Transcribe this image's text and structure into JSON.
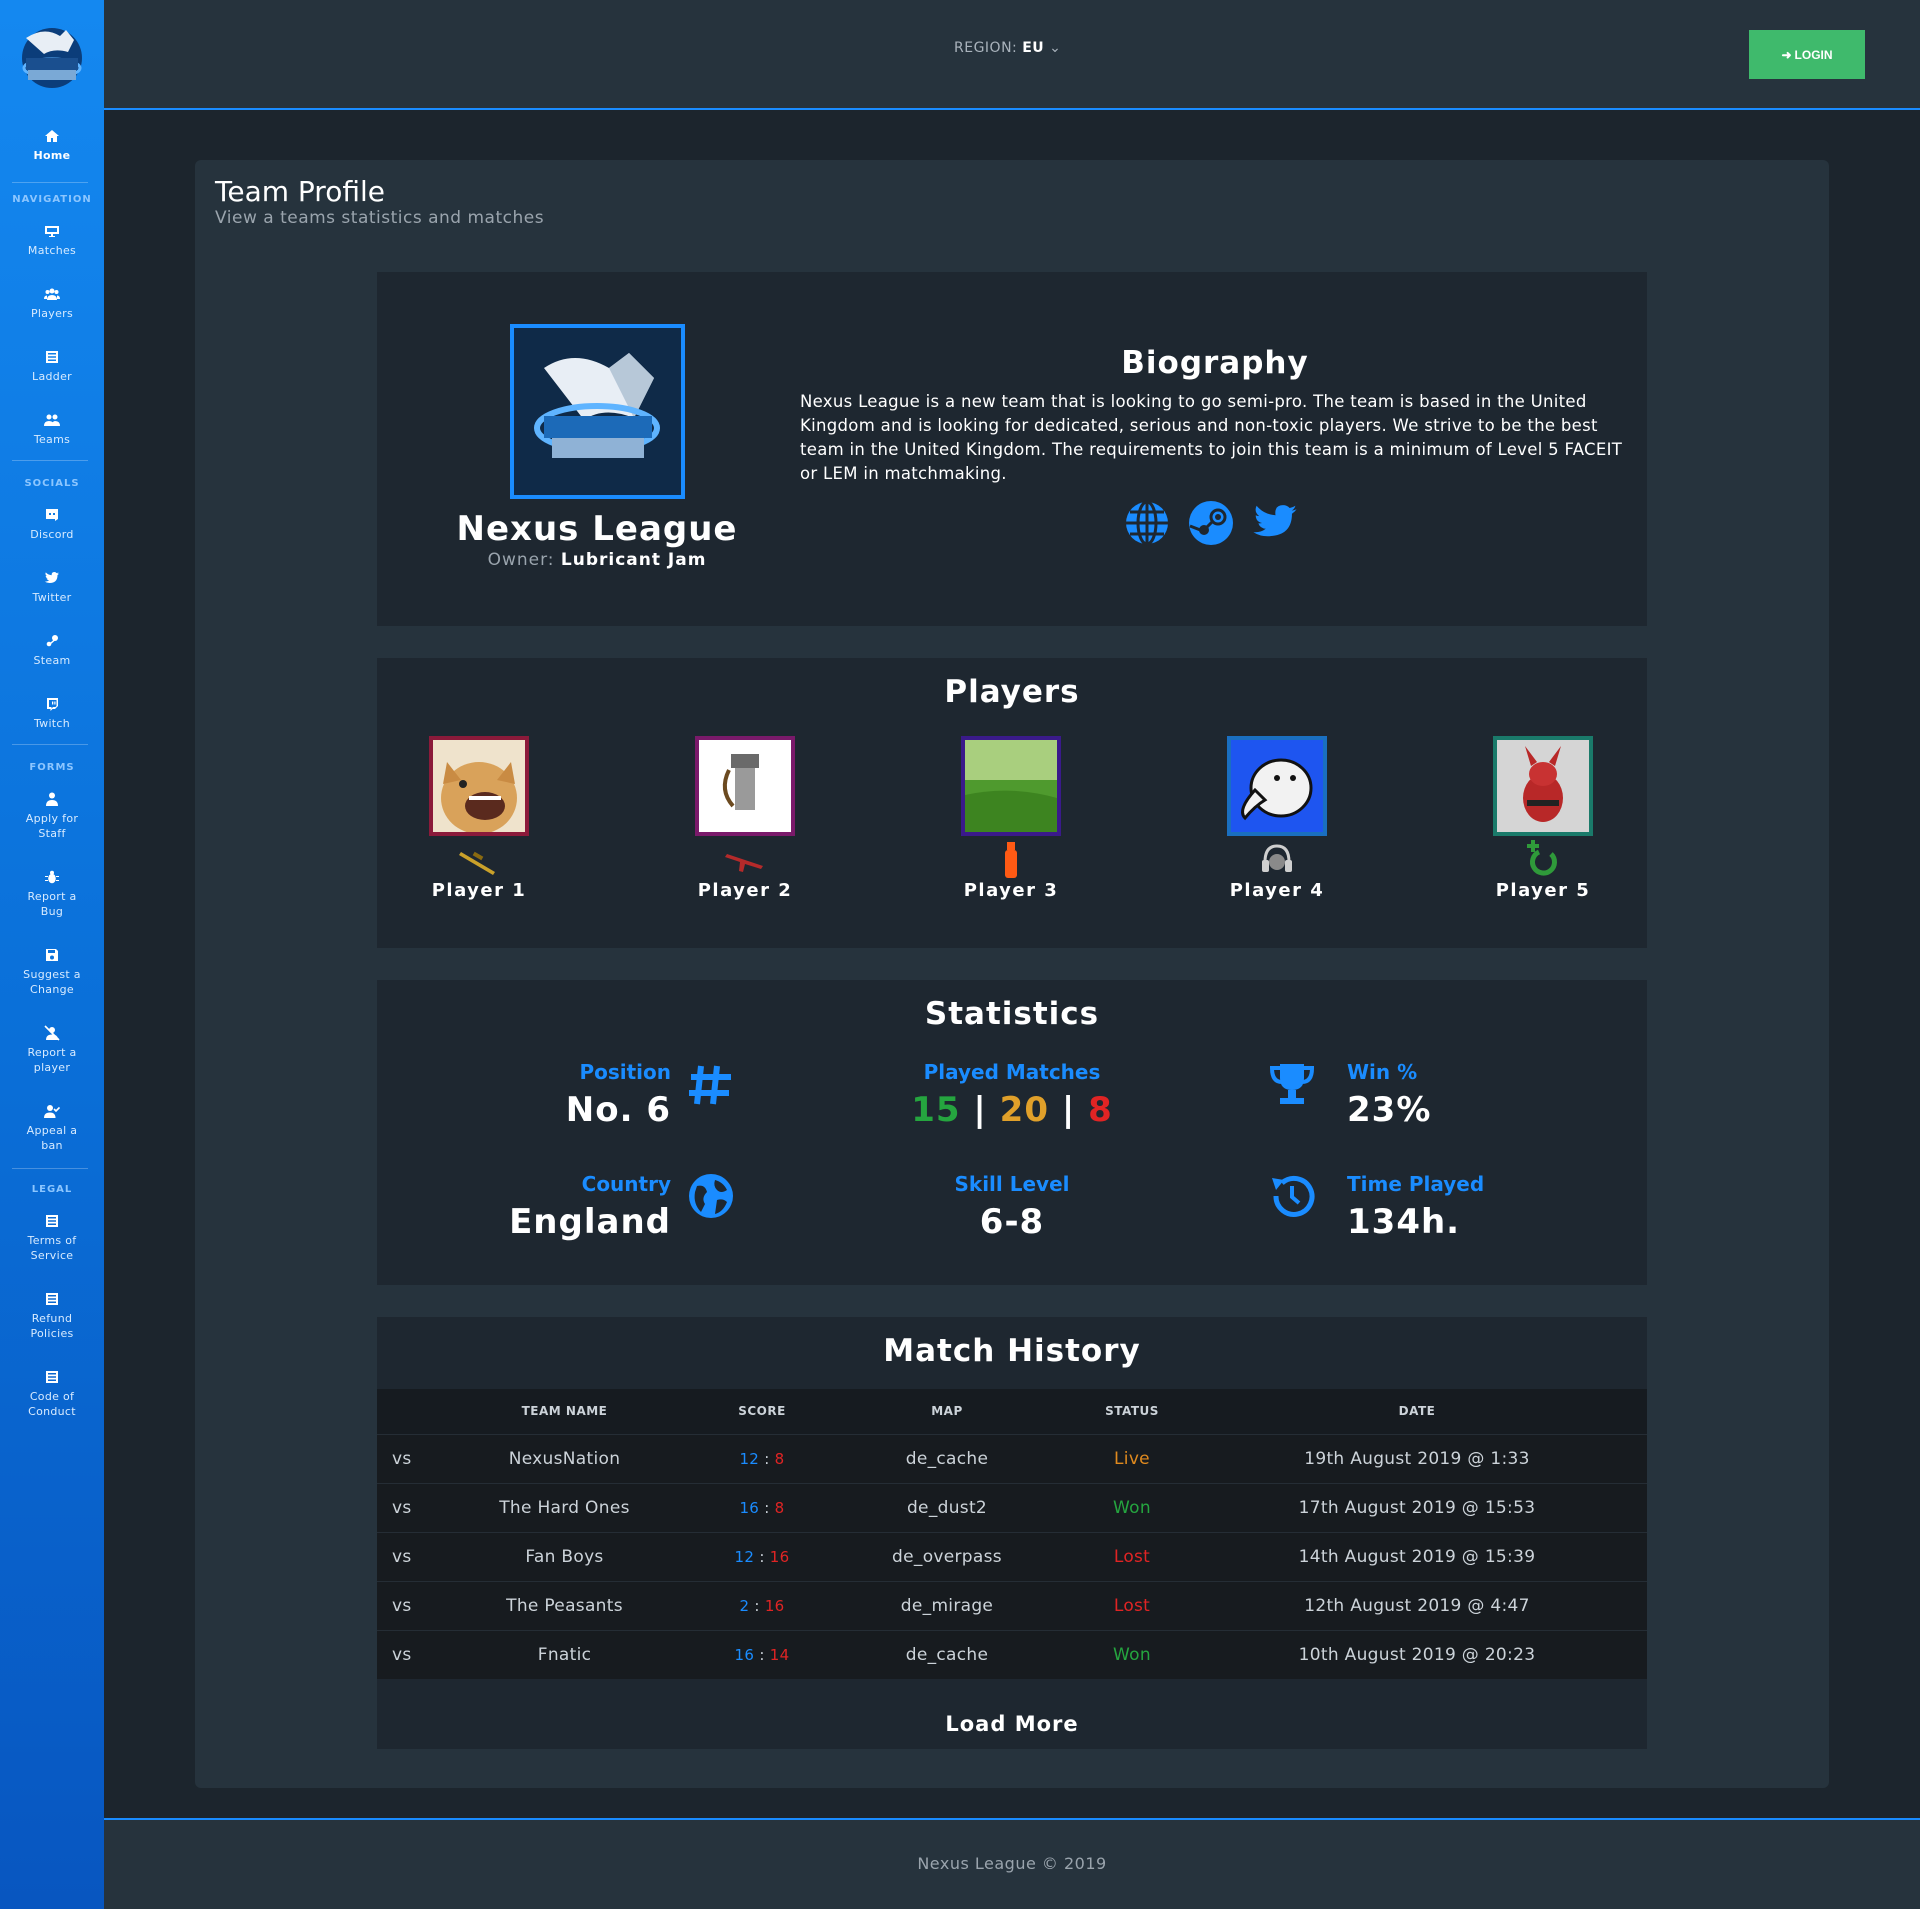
{
  "sidebar": {
    "home": "Home",
    "sections": {
      "navigation": "NAVIGATION",
      "socials": "SOCIALS",
      "forms": "FORMS",
      "legal": "LEGAL"
    },
    "nav": [
      "Matches",
      "Players",
      "Ladder",
      "Teams"
    ],
    "socials": [
      "Discord",
      "Twitter",
      "Steam",
      "Twitch"
    ],
    "forms": [
      [
        "Apply for",
        "Staff"
      ],
      [
        "Report a",
        "Bug"
      ],
      [
        "Suggest a",
        "Change"
      ],
      [
        "Report a",
        "player"
      ],
      [
        "Appeal a",
        "ban"
      ]
    ],
    "legal": [
      [
        "Terms of",
        "Service"
      ],
      [
        "Refund",
        "Policies"
      ],
      [
        "Code of",
        "Conduct"
      ]
    ]
  },
  "topbar": {
    "region_label": "REGION:",
    "region_value": "EU",
    "login": "LOGIN"
  },
  "page": {
    "title": "Team Profile",
    "subtitle": "View a teams statistics and matches"
  },
  "team": {
    "name": "Nexus League",
    "owner_label": "Owner:",
    "owner": "Lubricant Jam",
    "bio_heading": "Biography",
    "bio": "Nexus League is a new team that is looking to go semi-pro. The team is based in the United Kingdom and is looking for dedicated, serious and non-toxic players. We strive to be the best team in the United Kingdom. The requirements to join this team is a minimum of Level 5 FACEIT or LEM in matchmaking.",
    "socials": [
      "globe-icon",
      "steam-icon",
      "twitter-icon"
    ]
  },
  "players": {
    "heading": "Players",
    "list": [
      {
        "name": "Player 1",
        "border": "#8b1a3a",
        "role_icon": "sniper-rifle-icon"
      },
      {
        "name": "Player 2",
        "border": "#7a1a6a",
        "role_icon": "rifle-icon"
      },
      {
        "name": "Player 3",
        "border": "#3a1a8a",
        "role_icon": "extinguisher-icon"
      },
      {
        "name": "Player 4",
        "border": "#1a6fc0",
        "role_icon": "headset-icon"
      },
      {
        "name": "Player 5",
        "border": "#1a7a6a",
        "role_icon": "heal-icon"
      }
    ]
  },
  "stats": {
    "heading": "Statistics",
    "position_label": "Position",
    "position_value": "No. 6",
    "played_label": "Played Matches",
    "played_won": "15",
    "played_total": "20",
    "played_lost": "8",
    "sep": "|",
    "win_label": "Win %",
    "win_value": "23%",
    "country_label": "Country",
    "country_value": "England",
    "skill_label": "Skill Level",
    "skill_value": "6-8",
    "time_label": "Time Played",
    "time_value": "134h."
  },
  "matches": {
    "heading": "Match History",
    "columns": [
      "TEAM NAME",
      "SCORE",
      "MAP",
      "STATUS",
      "DATE"
    ],
    "rows": [
      {
        "vs": "vs",
        "team": "NexusNation",
        "score_a": "12",
        "score_b": "8",
        "map": "de_cache",
        "status": "Live",
        "date": "19th August 2019 @ 1:33"
      },
      {
        "vs": "vs",
        "team": "The Hard Ones",
        "score_a": "16",
        "score_b": "8",
        "map": "de_dust2",
        "status": "Won",
        "date": "17th August 2019 @ 15:53"
      },
      {
        "vs": "vs",
        "team": "Fan Boys",
        "score_a": "12",
        "score_b": "16",
        "map": "de_overpass",
        "status": "Lost",
        "date": "14th August 2019 @ 15:39"
      },
      {
        "vs": "vs",
        "team": "The Peasants",
        "score_a": "2",
        "score_b": "16",
        "map": "de_mirage",
        "status": "Lost",
        "date": "12th August 2019 @ 4:47"
      },
      {
        "vs": "vs",
        "team": "Fnatic",
        "score_a": "16",
        "score_b": "14",
        "map": "de_cache",
        "status": "Won",
        "date": "10th August 2019 @ 20:23"
      }
    ],
    "score_sep": ":",
    "load_more": "Load More"
  },
  "footer": {
    "text": "Nexus League © 2019"
  },
  "colors": {
    "accent": "#1a8cff",
    "login": "#3fba6c",
    "live": "#e08a1e",
    "won": "#25a53f",
    "lost": "#e02424"
  }
}
